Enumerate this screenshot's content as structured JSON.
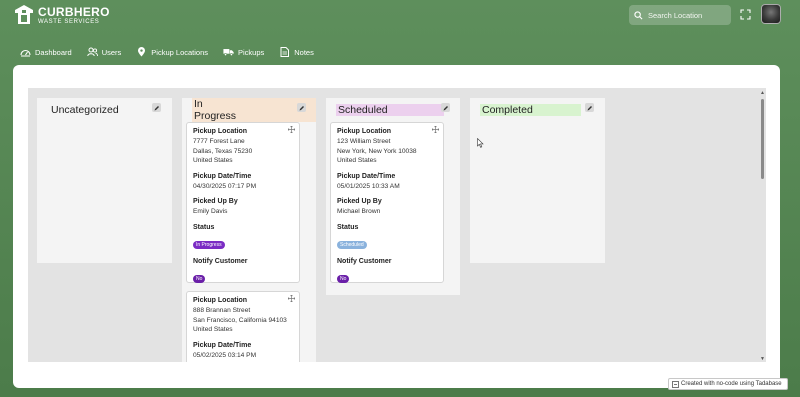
{
  "app": {
    "name": "CURBHERO",
    "subtitle": "WASTE SERVICES"
  },
  "search": {
    "placeholder": "Search Location"
  },
  "nav": [
    {
      "label": "Dashboard",
      "icon": "dashboard-icon"
    },
    {
      "label": "Users",
      "icon": "users-icon"
    },
    {
      "label": "Pickup Locations",
      "icon": "map-pin-icon"
    },
    {
      "label": "Pickups",
      "icon": "truck-icon"
    },
    {
      "label": "Notes",
      "icon": "note-icon"
    }
  ],
  "columns": [
    {
      "title": "Uncategorized",
      "highlight": "#f4f4f4"
    },
    {
      "title": "In Progress",
      "highlight": "#f7e4d2"
    },
    {
      "title": "Scheduled",
      "highlight": "#ecd0ee"
    },
    {
      "title": "Completed",
      "highlight": "#d8f3cf"
    }
  ],
  "labels": {
    "location": "Pickup Location",
    "datetime": "Pickup Date/Time",
    "picked_by": "Picked Up By",
    "status": "Status",
    "notify": "Notify Customer"
  },
  "cards": {
    "in_progress_1": {
      "address1": "7777 Forest Lane",
      "address2": "Dallas, Texas 75230",
      "country": "United States",
      "datetime": "04/30/2025 07:17 PM",
      "picked_by": "Emily Davis",
      "status": "In Progress",
      "notify": "No"
    },
    "in_progress_2": {
      "address1": "888 Brannan Street",
      "address2": "San Francisco, California 94103",
      "country": "United States",
      "datetime": "05/02/2025 03:14 PM"
    },
    "scheduled_1": {
      "address1": "123 William Street",
      "address2": "New York, New York 10038",
      "country": "United States",
      "datetime": "05/01/2025 10:33 AM",
      "picked_by": "Michael Brown",
      "status": "Scheduled",
      "notify": "No"
    }
  },
  "colors": {
    "in_progress_badge": "#7b2cc4",
    "scheduled_badge": "#8ab2dd",
    "no_badge": "#6a1fa8"
  },
  "footer": {
    "text": "Created with no-code using Tadabase"
  }
}
